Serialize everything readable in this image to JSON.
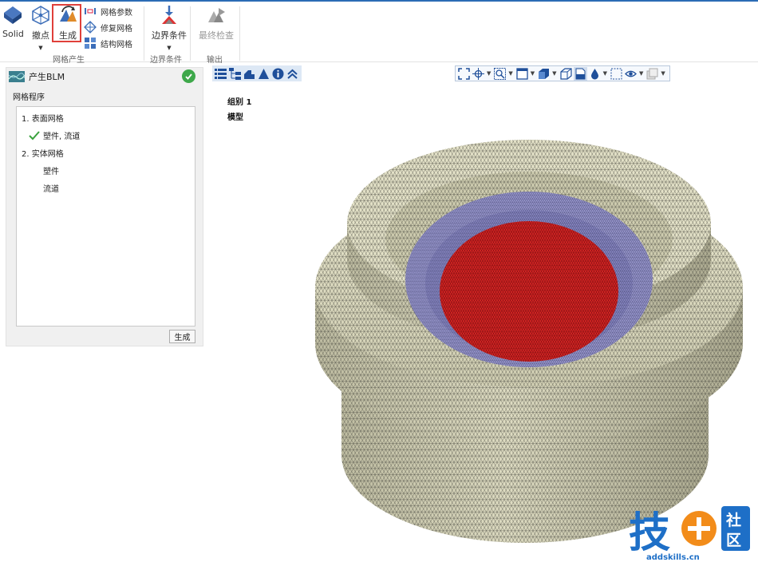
{
  "ribbon": {
    "solid_label": "Solid",
    "remove_points_label": "撤点",
    "generate_label": "生成",
    "mesh_params_label": "网格参数",
    "repair_mesh_label": "修复网格",
    "structured_mesh_label": "结构网格",
    "mesh_generation_group": "网格产生",
    "boundary_label": "边界条件",
    "boundary_group": "边界条件",
    "final_check_label": "最终检查",
    "output_group": "输出"
  },
  "panel": {
    "title": "产生BLM",
    "section": "网格程序",
    "tree": [
      {
        "label": "1. 表面网格"
      },
      {
        "label": "塑件, 流道",
        "checked": true
      },
      {
        "label": "2. 实体网格"
      },
      {
        "label": "塑件"
      },
      {
        "label": "流道"
      }
    ],
    "generate_button": "生成"
  },
  "viewport": {
    "group_label": "组别 1",
    "model_label": "模型"
  },
  "watermark": {
    "url": "addskills.cn"
  },
  "colors": {
    "accent": "#2b6cb5",
    "mesh_body": "#d8d6b8",
    "mesh_purple": "#9b9ad0",
    "mesh_red": "#d42424",
    "highlight": "#e0403a"
  }
}
